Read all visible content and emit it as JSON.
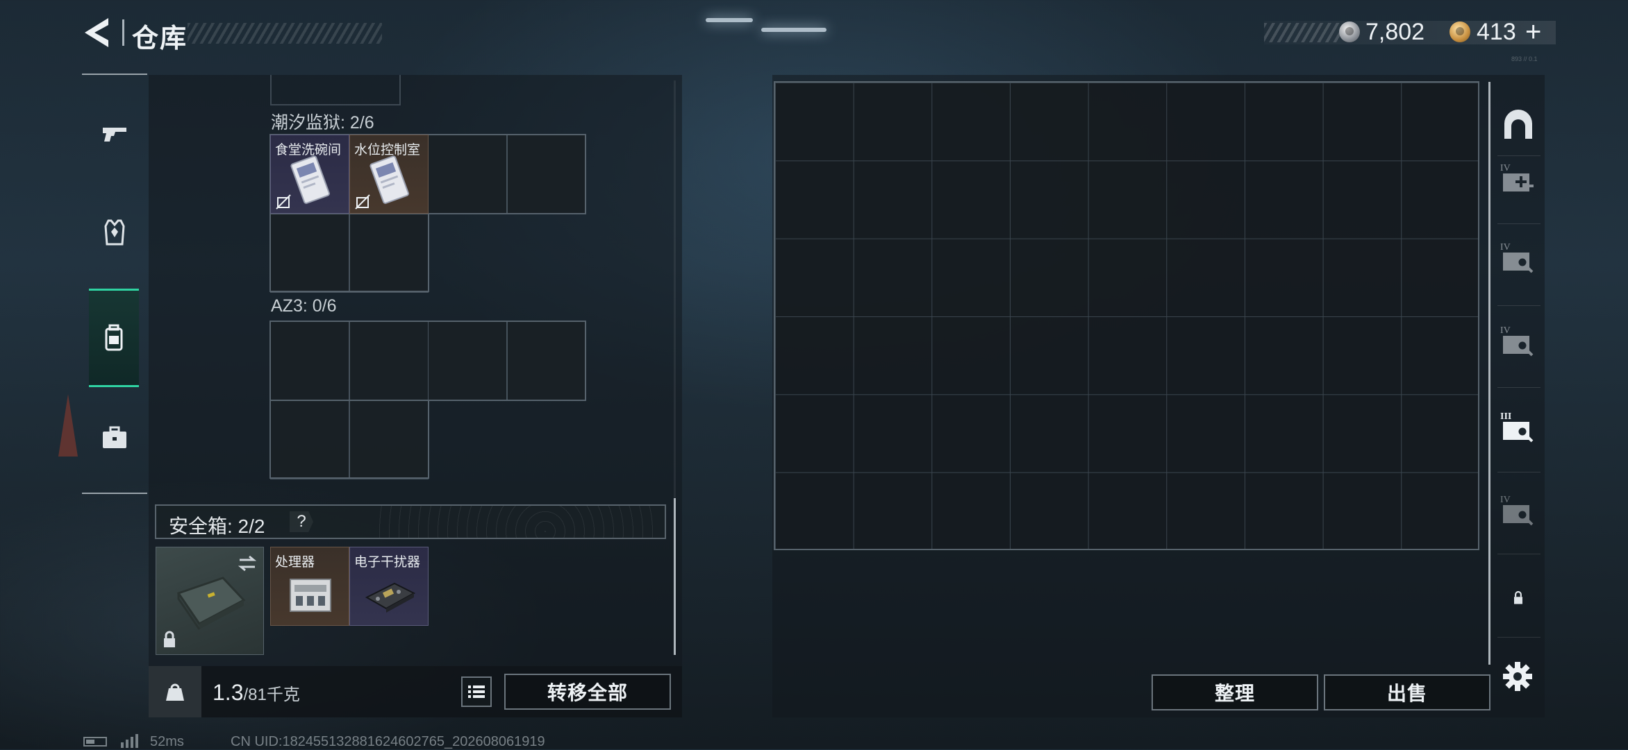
{
  "header": {
    "title": "仓库",
    "currencies": [
      {
        "name": "silver-coin",
        "value": "7,802"
      },
      {
        "name": "gold-coin",
        "value": "413"
      }
    ],
    "add_label": "+",
    "version_code": "893 // 0.1"
  },
  "left_tabs": [
    {
      "icon": "pistol-icon",
      "active": false
    },
    {
      "icon": "armor-vest-icon",
      "active": false
    },
    {
      "icon": "backpack-icon",
      "active": true
    },
    {
      "icon": "briefcase-icon",
      "active": false
    }
  ],
  "storage": {
    "sections": [
      {
        "label": "潮汐监狱: 2/6",
        "items": [
          {
            "name": "食堂洗碗间",
            "rarity": "purple",
            "icon": "keycard-icon"
          },
          {
            "name": "水位控制室",
            "rarity": "brown",
            "icon": "keycard-icon"
          }
        ]
      },
      {
        "label": "AZ3: 0/6",
        "items": []
      }
    ],
    "safebox": {
      "label": "安全箱:  2/2",
      "help": "?",
      "items": [
        {
          "name": "处理器",
          "rarity": "brown",
          "icon": "processor-icon"
        },
        {
          "name": "电子干扰器",
          "rarity": "purple",
          "icon": "jammer-icon"
        }
      ]
    }
  },
  "footer": {
    "weight_value": "1.3",
    "weight_capacity": "/81千克",
    "transfer_all": "转移全部",
    "sort": "整理",
    "sell": "出售"
  },
  "right_rail": [
    {
      "icon": "helmet-icon",
      "tier": ""
    },
    {
      "icon": "add-vehicle-icon",
      "tier": "IV"
    },
    {
      "icon": "vehicle-search-icon",
      "tier": "IV"
    },
    {
      "icon": "vehicle-search-icon",
      "tier": "IV"
    },
    {
      "icon": "vehicle-search-icon",
      "tier": "III"
    },
    {
      "icon": "vehicle-search-icon",
      "tier": "IV"
    },
    {
      "icon": "lock-icon",
      "tier": ""
    }
  ],
  "status_bar": {
    "ping": "52ms",
    "uid": "CN UID:1824551328816246027​65_202608061919"
  },
  "colors": {
    "accent": "#2fd3a2",
    "rarity_purple": "#34344f",
    "rarity_brown": "#47382d"
  }
}
